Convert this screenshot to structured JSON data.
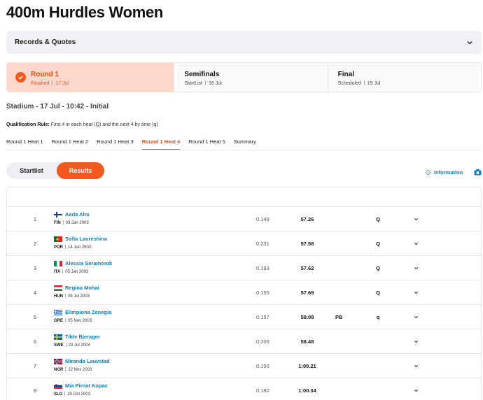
{
  "page": {
    "title": "400m Hurdles Women"
  },
  "records": {
    "label": "Records & Quotes"
  },
  "rounds": [
    {
      "name": "Round 1",
      "status": "Finished",
      "date": "17 Jul",
      "active": true
    },
    {
      "name": "Semifinals",
      "status": "StartList",
      "date": "18 Jul",
      "active": false
    },
    {
      "name": "Final",
      "status": "Scheduled",
      "date": "19 Jul",
      "active": false
    }
  ],
  "session": {
    "text": "Stadium - 17 Jul - 10:42 - Initial"
  },
  "qualification": {
    "label": "Qualification Rule:",
    "text": "First 4 in each heat (Q) and the next 4 by time (q)"
  },
  "heat_tabs": [
    "Round 1 Heat 1",
    "Round 1 Heat 2",
    "Round 1 Heat 3",
    "Round 1 Heat 4",
    "Round 1 Heat 5",
    "Summary"
  ],
  "active_tab": 3,
  "view_toggle": {
    "startlist": "Startlist",
    "results": "Results"
  },
  "info": {
    "label": "Information"
  },
  "colors": {
    "accent": "#f05a1e",
    "link": "#0a7fc2",
    "active_round_bg": "#fcd8cc"
  },
  "results": [
    {
      "rank": "1",
      "name": "Aada Aho",
      "country": "FIN",
      "dob": "03 Jan 2003",
      "reaction": "0.149",
      "time": "57.26",
      "note": "",
      "qual": "Q",
      "flag": "fin"
    },
    {
      "rank": "2",
      "name": "Sofia Lavreshina",
      "country": "POR",
      "dob": "14 Jun 2003",
      "reaction": "0.231",
      "time": "57.58",
      "note": "",
      "qual": "Q",
      "flag": "por"
    },
    {
      "rank": "3",
      "name": "Alessia Seramondi",
      "country": "ITA",
      "dob": "05 Jan 2003",
      "reaction": "0.193",
      "time": "57.62",
      "note": "",
      "qual": "Q",
      "flag": "ita"
    },
    {
      "rank": "4",
      "name": "Regina Mohai",
      "country": "HUN",
      "dob": "08 Jul 2003",
      "reaction": "0.155",
      "time": "57.69",
      "note": "",
      "qual": "Q",
      "flag": "hun"
    },
    {
      "rank": "5",
      "name": "Elimpiona Zenegia",
      "country": "GRE",
      "dob": "05 Nov 2003",
      "reaction": "0.157",
      "time": "58.08",
      "note": "PB",
      "qual": "q",
      "flag": "gre"
    },
    {
      "rank": "6",
      "name": "Tilde Bjerager",
      "country": "SWE",
      "dob": "20 Jul 2004",
      "reaction": "0.206",
      "time": "58.48",
      "note": "",
      "qual": "",
      "flag": "swe"
    },
    {
      "rank": "7",
      "name": "Miranda Lauvstad",
      "country": "NOR",
      "dob": "22 Nov 2003",
      "reaction": "0.150",
      "time": "1:00.21",
      "note": "",
      "qual": "",
      "flag": "nor"
    },
    {
      "rank": "8",
      "name": "Mia Pirnat Kopac",
      "country": "SLO",
      "dob": "20 Oct 2003",
      "reaction": "0.180",
      "time": "1:00.34",
      "note": "",
      "qual": "",
      "flag": "slo"
    }
  ]
}
